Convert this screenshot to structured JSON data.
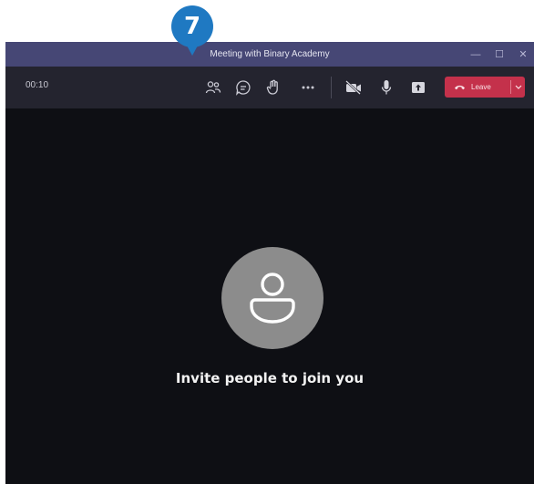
{
  "step_badge": "7",
  "window": {
    "title": "Meeting with Binary Academy",
    "controls": {
      "minimize": "—",
      "maximize": "☐",
      "close": "✕"
    }
  },
  "toolbar": {
    "timer": "00:10",
    "icons": [
      "people-icon",
      "chat-icon",
      "raise-hand-icon",
      "more-icon",
      "camera-off-icon",
      "mic-icon",
      "share-screen-icon"
    ],
    "leave_label": "Leave"
  },
  "stage": {
    "invite_text": "Invite people to join you"
  },
  "colors": {
    "titlebar": "#464775",
    "toolbar": "#24242f",
    "stage": "#0e0f14",
    "leave_button": "#c4314b",
    "badge": "#1f79c2",
    "avatar": "#8c8c8c"
  }
}
